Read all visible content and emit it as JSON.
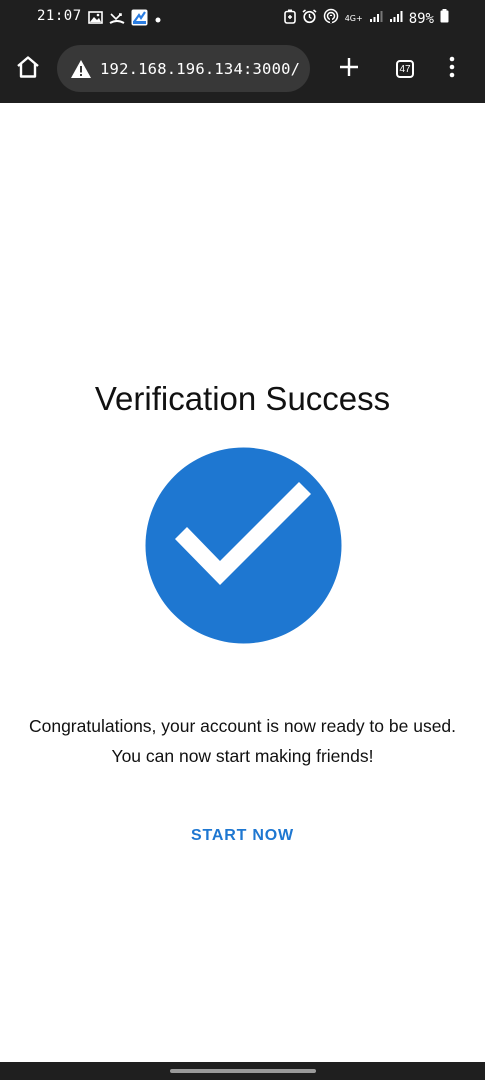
{
  "status_bar": {
    "time": "21:07",
    "battery": "89%",
    "network": "4G+",
    "icons": [
      "gallery-icon",
      "call-missed-icon",
      "app-icon",
      "dot-icon",
      "battery-saver-icon",
      "alarm-icon",
      "hotspot-icon",
      "network-4g-icon",
      "signal-icon",
      "signal-icon",
      "battery-icon"
    ]
  },
  "browser": {
    "url": "192.168.196.134:3000/",
    "tab_count": "47",
    "icons": [
      "home-icon",
      "warning-icon",
      "plus-icon",
      "tabs-icon",
      "more-vert-icon"
    ]
  },
  "content": {
    "title": "Verification Success",
    "message_line1": "Congratulations, your account is now ready to be used.",
    "message_line2": "You can now start making friends!",
    "button_label": "START NOW",
    "badge_icon": "check-circle-icon"
  },
  "colors": {
    "accent": "#1e77d1",
    "bar_background": "#1f1f1f",
    "url_background": "#383838"
  }
}
